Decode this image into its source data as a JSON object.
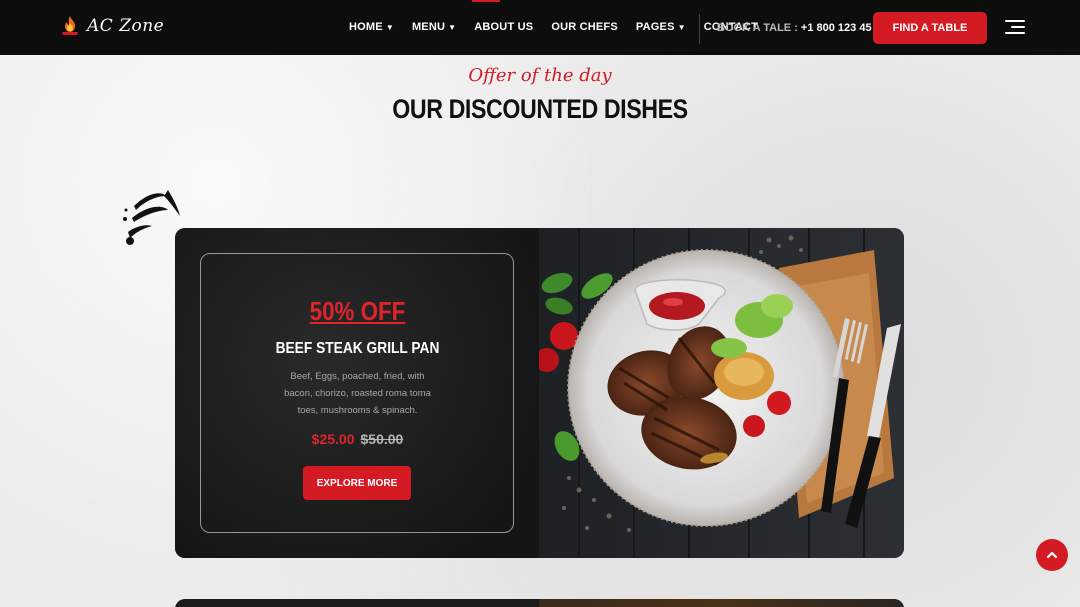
{
  "brand": {
    "name": "AC Zone",
    "icon": "flame-icon"
  },
  "nav": {
    "items": [
      {
        "label": "HOME",
        "has_dropdown": true
      },
      {
        "label": "MENU",
        "has_dropdown": true
      },
      {
        "label": "ABOUT US",
        "has_dropdown": false
      },
      {
        "label": "OUR CHEFS",
        "has_dropdown": false
      },
      {
        "label": "PAGES",
        "has_dropdown": true
      },
      {
        "label": "CONTACT",
        "has_dropdown": false
      }
    ],
    "book_label": "BOOK A TALE : ",
    "book_phone": "+1 800 123 45 78",
    "cta_label": "FIND A TABLE"
  },
  "section": {
    "tagline": "Offer of the day",
    "title": "OUR DISCOUNTED DISHES"
  },
  "offer_card": {
    "discount": "50% OFF",
    "dish_name": "BEEF STEAK GRILL PAN",
    "description": "Beef, Eggs, poached, fried, with bacon, chorizo, roasted roma toma toes, mushrooms & spinach.",
    "price_new": "$25.00",
    "price_old": "$50.00",
    "button_label": "EXPLORE MORE"
  },
  "colors": {
    "accent": "#d41b24",
    "nav_bg": "#0d0d0d",
    "card_bg": "#1b1b1b"
  }
}
